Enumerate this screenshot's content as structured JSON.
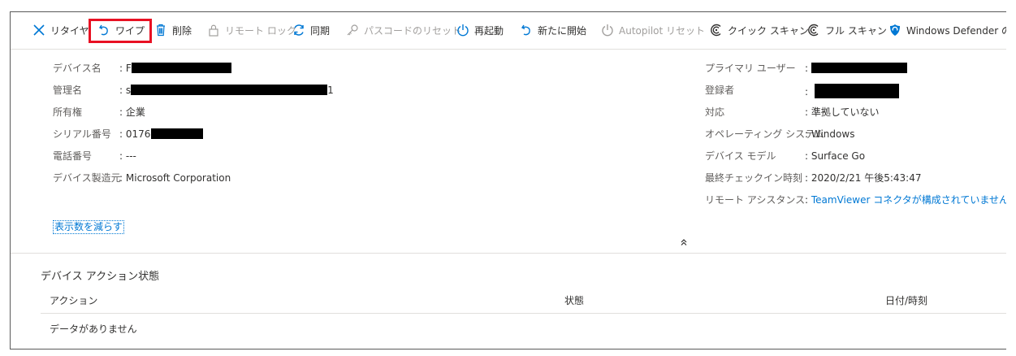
{
  "toolbar": {
    "items": [
      {
        "label": "リタイヤ"
      },
      {
        "label": "ワイプ"
      },
      {
        "label": "削除"
      },
      {
        "label": "リモート ロック"
      },
      {
        "label": "同期"
      },
      {
        "label": "パスコードのリセット"
      },
      {
        "label": "再起動"
      },
      {
        "label": "新たに開始"
      },
      {
        "label": "Autopilot リセット"
      },
      {
        "label": "クイック スキャン"
      },
      {
        "label": "フル スキャン"
      },
      {
        "label": "Windows Defender の"
      }
    ]
  },
  "details_left": [
    {
      "label": "デバイス名",
      "value": "F"
    },
    {
      "label": "管理名",
      "value": "s",
      "value_tail": "1"
    },
    {
      "label": "所有権",
      "value": "企業"
    },
    {
      "label": "シリアル番号",
      "value": "0176"
    },
    {
      "label": "電話番号",
      "value": "---"
    },
    {
      "label": "デバイス製造元",
      "value": "Microsoft Corporation"
    }
  ],
  "details_right": [
    {
      "label": "プライマリ ユーザー",
      "value": ""
    },
    {
      "label": "登録者",
      "value": ""
    },
    {
      "label": "対応",
      "value": "準拠していない"
    },
    {
      "label": "オペレーティング システム",
      "value": "Windows"
    },
    {
      "label": "デバイス モデル",
      "value": "Surface Go"
    },
    {
      "label": "最終チェックイン時刻",
      "value": "2020/2/21 午後5:43:47"
    },
    {
      "label": "リモート アシスタンス",
      "value": "TeamViewer コネクタが構成されていません"
    }
  ],
  "separator": ":",
  "show_less": "表示数を減らす",
  "actions": {
    "title": "デバイス アクション状態",
    "columns": [
      "アクション",
      "状態",
      "日付/時刻"
    ],
    "empty": "データがありません"
  },
  "colors": {
    "accent": "#0078d4",
    "highlight": "#e81123",
    "disabled": "#a19f9d"
  }
}
